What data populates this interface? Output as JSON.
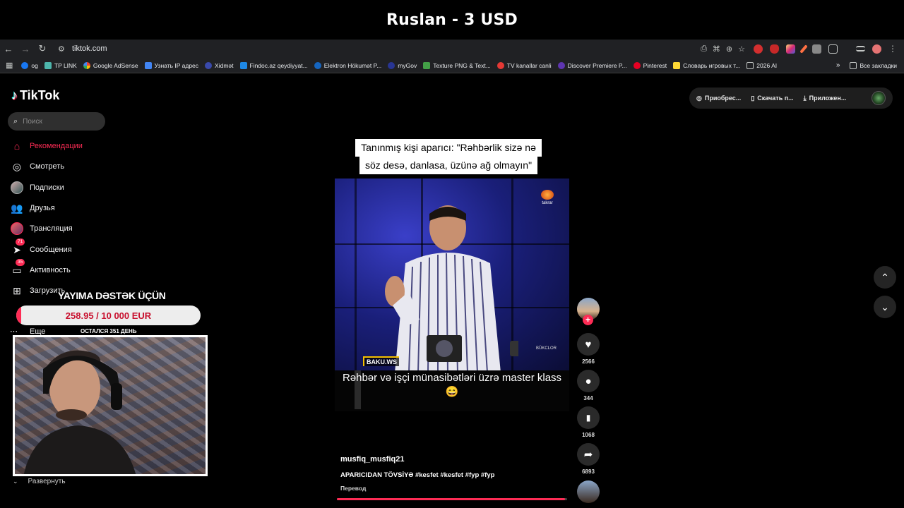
{
  "stream": {
    "title": "Ruslan - 3 USD",
    "donation_title": "YAYIMA DƏSTƏK ÜÇÜN",
    "donation_amount": "258.95 / 10 000 EUR",
    "donation_progress_fraction": 0.026,
    "days_left": "ОСТАЛСЯ 351 ДЕНЬ"
  },
  "browser": {
    "url": "tiktok.com",
    "bookmarks": [
      {
        "label": "og",
        "color": "#1877f2"
      },
      {
        "label": "TP LINK",
        "color": "#4db6ac"
      },
      {
        "label": "Google AdSense",
        "color": "#fbbc04"
      },
      {
        "label": "Узнать IP адрес",
        "color": "#4285f4"
      },
      {
        "label": "Xidmət",
        "color": "#3949ab"
      },
      {
        "label": "Findoc.az qeydiyyat...",
        "color": "#1e88e5"
      },
      {
        "label": "Elektron Hökumət P...",
        "color": "#1565c0"
      },
      {
        "label": "myGov",
        "color": "#283593"
      },
      {
        "label": "Texture PNG & Text...",
        "color": "#43a047"
      },
      {
        "label": "TV kanallar canli",
        "color": "#e53935"
      },
      {
        "label": "Discover Premiere P...",
        "color": "#5e35b1"
      },
      {
        "label": "Pinterest",
        "color": "#e60023"
      },
      {
        "label": "Словарь игровых т...",
        "color": "#fdd835"
      },
      {
        "label": "2026 AI",
        "color": "#9e9e9e"
      }
    ],
    "all_bookmarks": "Все закладки"
  },
  "tiktok": {
    "brand": "TikTok",
    "search_placeholder": "Поиск",
    "nav": [
      {
        "label": "Рекомендации",
        "icon": "home-icon"
      },
      {
        "label": "Смотреть",
        "icon": "compass-icon"
      },
      {
        "label": "Подписки",
        "icon": "following-avatar-icon"
      },
      {
        "label": "Друзья",
        "icon": "friends-icon"
      },
      {
        "label": "Трансляция",
        "icon": "live-avatar-icon"
      },
      {
        "label": "Сообщения",
        "icon": "messages-icon",
        "badge": "71"
      },
      {
        "label": "Активность",
        "icon": "activity-icon",
        "badge": "35"
      },
      {
        "label": "Загрузить",
        "icon": "upload-icon"
      }
    ],
    "more_label": "Еще",
    "expand_label": "Развернуть",
    "top_actions": [
      "Приобрес...",
      "Скачать п...",
      "Приложен..."
    ]
  },
  "video": {
    "caption_line1": "Tanınmış kişi aparıcı: \"Rəhbərlik sizə nə",
    "caption_line2": "söz desə, danlasa, üzünə ağ olmayın\"",
    "channel_logo": "takrar",
    "watermark": "BAKU.WS",
    "corner_tag": "BÜKCLOR",
    "subtitle": "Rəhbər və işçi münasibətləri üzrə master klass 😄",
    "author": "musfiq_musfiq21",
    "description": "APARICIDAN TÖVSİYƏ #kesfet #kesfet #fyp #fyp",
    "translate": "Перевод",
    "progress_fraction": 0.99,
    "likes": "2566",
    "comments": "344",
    "saves": "1068",
    "shares": "6893"
  }
}
